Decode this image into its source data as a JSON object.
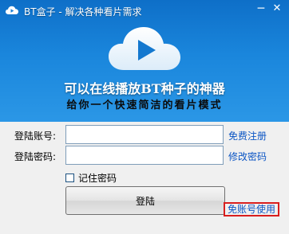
{
  "window": {
    "title": "BT盒子 - 解决各种看片需求",
    "minimize_glyph": "─",
    "close_glyph": "✕"
  },
  "banner": {
    "slogan_main": "可以在线播放BT种子的神器",
    "slogan_sub": "给你一个快速简洁的看片模式",
    "logo_icon": "cloud-play-icon"
  },
  "form": {
    "account_label": "登陆账号:",
    "account_value": "",
    "password_label": "登陆密码:",
    "password_value": "",
    "register_link": "免费注册",
    "change_password_link": "修改密码",
    "remember_label": "记住密码",
    "remember_checked": false,
    "login_button": "登陆",
    "free_use_link": "免账号使用"
  },
  "colors": {
    "banner_top": "#0e6fc8",
    "banner_bottom": "#2b97e6",
    "link": "#0b55c4",
    "highlight_border": "#d81e1e"
  }
}
